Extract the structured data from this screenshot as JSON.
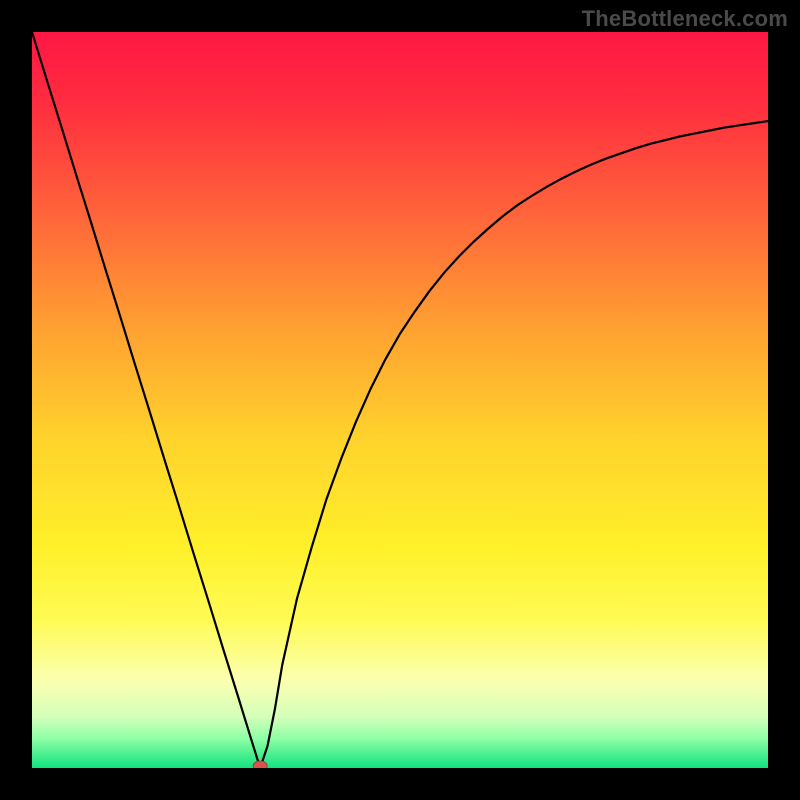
{
  "watermark": "TheBottleneck.com",
  "chart_data": {
    "type": "line",
    "title": "",
    "xlabel": "",
    "ylabel": "",
    "xlim": [
      0,
      100
    ],
    "ylim": [
      0,
      100
    ],
    "x": [
      0,
      2,
      4,
      6,
      8,
      10,
      12,
      14,
      16,
      18,
      20,
      22,
      24,
      26,
      28,
      30,
      31,
      32,
      33,
      34,
      36,
      38,
      40,
      42,
      44,
      46,
      48,
      50,
      52,
      54,
      56,
      58,
      60,
      62,
      64,
      66,
      68,
      70,
      72,
      74,
      76,
      78,
      80,
      82,
      84,
      86,
      88,
      90,
      92,
      94,
      96,
      98,
      100
    ],
    "values": [
      100,
      93.5,
      87.1,
      80.6,
      74.2,
      67.7,
      61.3,
      54.8,
      48.4,
      41.9,
      35.5,
      29.0,
      22.6,
      16.1,
      9.7,
      3.2,
      0.0,
      3.0,
      8.0,
      14.0,
      23.0,
      30.0,
      36.5,
      42.0,
      47.0,
      51.5,
      55.5,
      59.0,
      62.0,
      64.8,
      67.3,
      69.5,
      71.5,
      73.3,
      75.0,
      76.5,
      77.8,
      79.0,
      80.1,
      81.1,
      82.0,
      82.8,
      83.5,
      84.2,
      84.8,
      85.3,
      85.8,
      86.2,
      86.6,
      87.0,
      87.3,
      87.6,
      87.9
    ],
    "marker": {
      "x": 31,
      "y": 0
    },
    "gradient_stops": [
      {
        "offset": 0.0,
        "color": "#ff1744"
      },
      {
        "offset": 0.1,
        "color": "#ff2e3f"
      },
      {
        "offset": 0.25,
        "color": "#ff653a"
      },
      {
        "offset": 0.4,
        "color": "#ffa032"
      },
      {
        "offset": 0.55,
        "color": "#ffd22c"
      },
      {
        "offset": 0.7,
        "color": "#fff02a"
      },
      {
        "offset": 0.8,
        "color": "#fffb55"
      },
      {
        "offset": 0.88,
        "color": "#fbffb0"
      },
      {
        "offset": 0.93,
        "color": "#d5ffba"
      },
      {
        "offset": 0.96,
        "color": "#8effa5"
      },
      {
        "offset": 1.0,
        "color": "#11e27f"
      }
    ]
  }
}
